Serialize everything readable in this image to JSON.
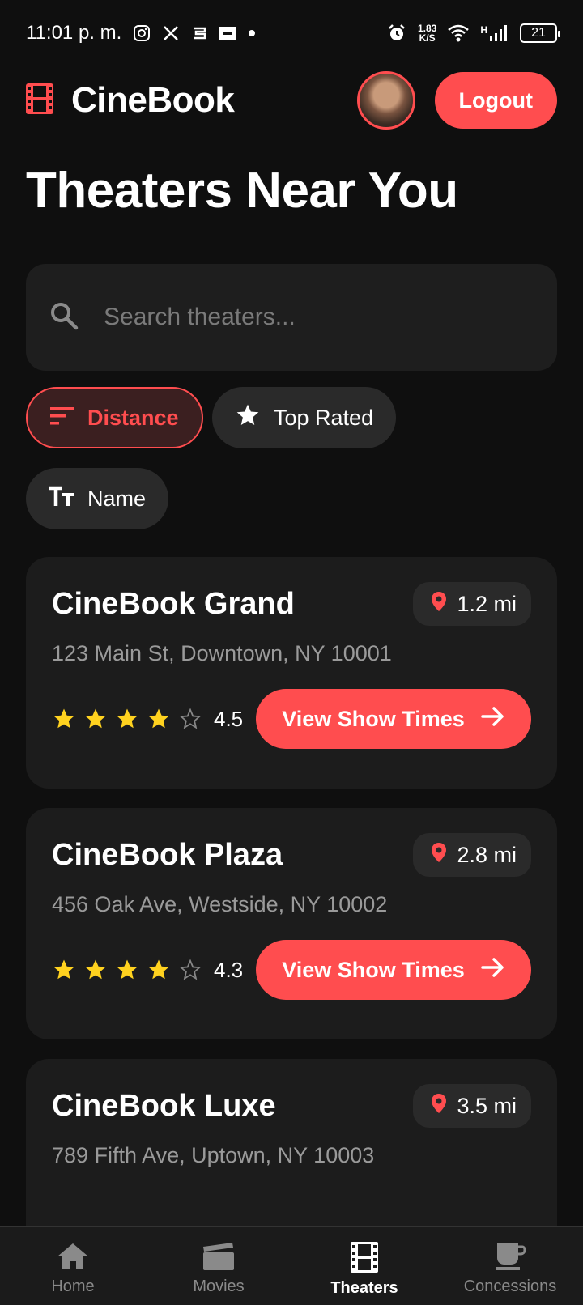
{
  "status_bar": {
    "time": "11:01 p. m.",
    "speed_value": "1.83",
    "speed_unit": "K/S",
    "network": "H",
    "battery": "21"
  },
  "header": {
    "app_name": "CineBook",
    "logout_label": "Logout"
  },
  "page_title": "Theaters Near You",
  "search": {
    "placeholder": "Search theaters..."
  },
  "filters": [
    {
      "label": "Distance",
      "icon": "sort-icon",
      "active": true
    },
    {
      "label": "Top Rated",
      "icon": "star-icon",
      "active": false
    },
    {
      "label": "Name",
      "icon": "text-size-icon",
      "active": false
    }
  ],
  "theaters": [
    {
      "name": "CineBook Grand",
      "distance": "1.2 mi",
      "address": "123 Main St, Downtown, NY 10001",
      "rating": "4.5",
      "stars_filled": 4,
      "button_label": "View Show Times"
    },
    {
      "name": "CineBook Plaza",
      "distance": "2.8 mi",
      "address": "456 Oak Ave, Westside, NY 10002",
      "rating": "4.3",
      "stars_filled": 4,
      "button_label": "View Show Times"
    },
    {
      "name": "CineBook Luxe",
      "distance": "3.5 mi",
      "address": "789 Fifth Ave, Uptown, NY 10003"
    }
  ],
  "bottom_nav": [
    {
      "label": "Home",
      "icon": "home-icon",
      "active": false
    },
    {
      "label": "Movies",
      "icon": "clapperboard-icon",
      "active": false
    },
    {
      "label": "Theaters",
      "icon": "film-strip-icon",
      "active": true
    },
    {
      "label": "Concessions",
      "icon": "coffee-cup-icon",
      "active": false
    }
  ],
  "colors": {
    "accent": "#ff4d4f",
    "background": "#0f0f0f",
    "card": "#1c1c1c",
    "star": "#ffd21f"
  }
}
